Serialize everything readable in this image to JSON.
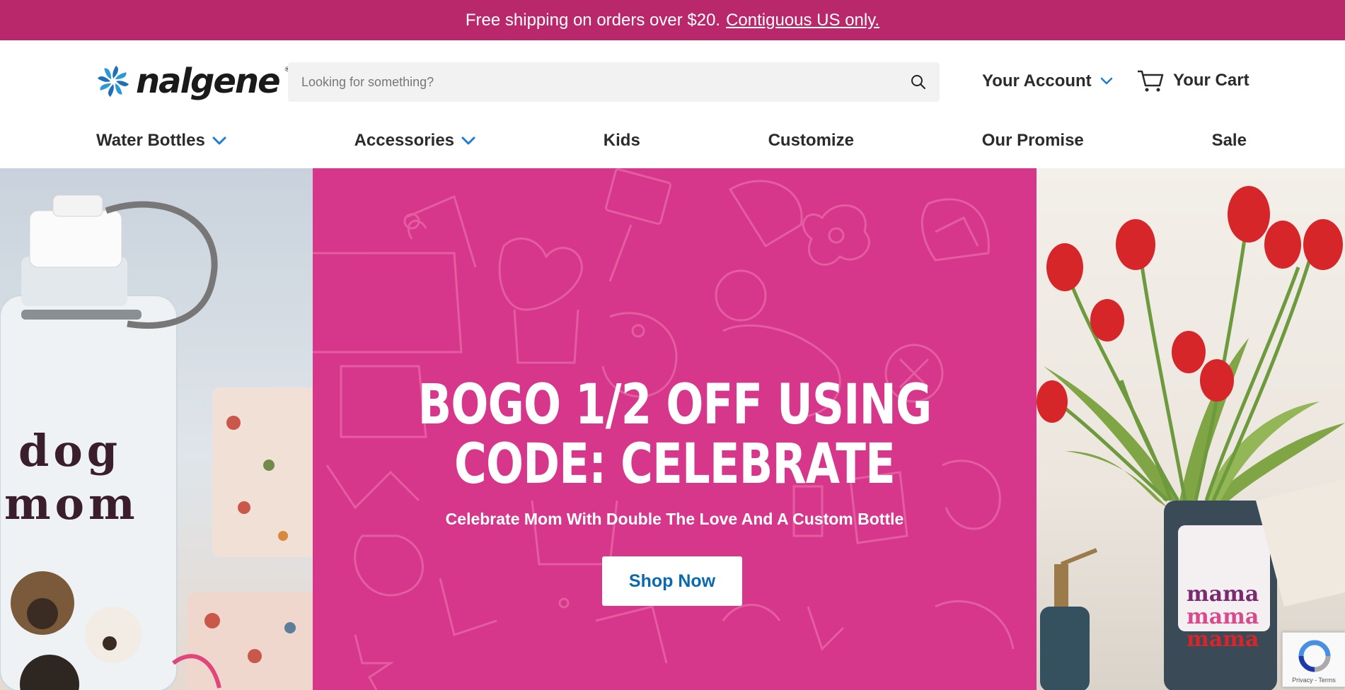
{
  "promo": {
    "text": "Free shipping on orders over $20.",
    "link": "Contiguous US only."
  },
  "brand": {
    "logo_text": "nalgene",
    "reg_mark": "®",
    "logo_colors": [
      "#1f6fb8",
      "#2a9ad6"
    ]
  },
  "search": {
    "placeholder": "Looking for something?",
    "value": "",
    "icon": "search-icon"
  },
  "account": {
    "label": "Your Account",
    "icon": "chevron-down-icon"
  },
  "cart": {
    "label": "Your Cart",
    "icon": "cart-icon"
  },
  "nav": {
    "items": [
      {
        "label": "Water Bottles",
        "has_dropdown": true
      },
      {
        "label": "Accessories",
        "has_dropdown": true
      },
      {
        "label": "Kids",
        "has_dropdown": false
      },
      {
        "label": "Customize",
        "has_dropdown": false
      },
      {
        "label": "Our Promise",
        "has_dropdown": false
      },
      {
        "label": "Sale",
        "has_dropdown": false
      }
    ]
  },
  "hero": {
    "headline_line1": "BOGO 1/2 OFF USING",
    "headline_line2": "CODE: CELEBRATE",
    "subheadline": "Celebrate Mom With Double The Love And A Custom Bottle",
    "cta": "Shop Now",
    "left_image": {
      "sticker_line1": "dog",
      "sticker_line2": "mom"
    },
    "right_image": {
      "sticker_lines": [
        "mama",
        "mama",
        "mama"
      ]
    }
  },
  "recaptcha": {
    "links": "Privacy - Terms"
  },
  "colors": {
    "promo_bg": "#b8286a",
    "hero_bg": "#d6378a",
    "accent_blue": "#0a6ab0",
    "chevron_blue": "#1a7fd1",
    "text_dark": "#2b2b2b"
  }
}
